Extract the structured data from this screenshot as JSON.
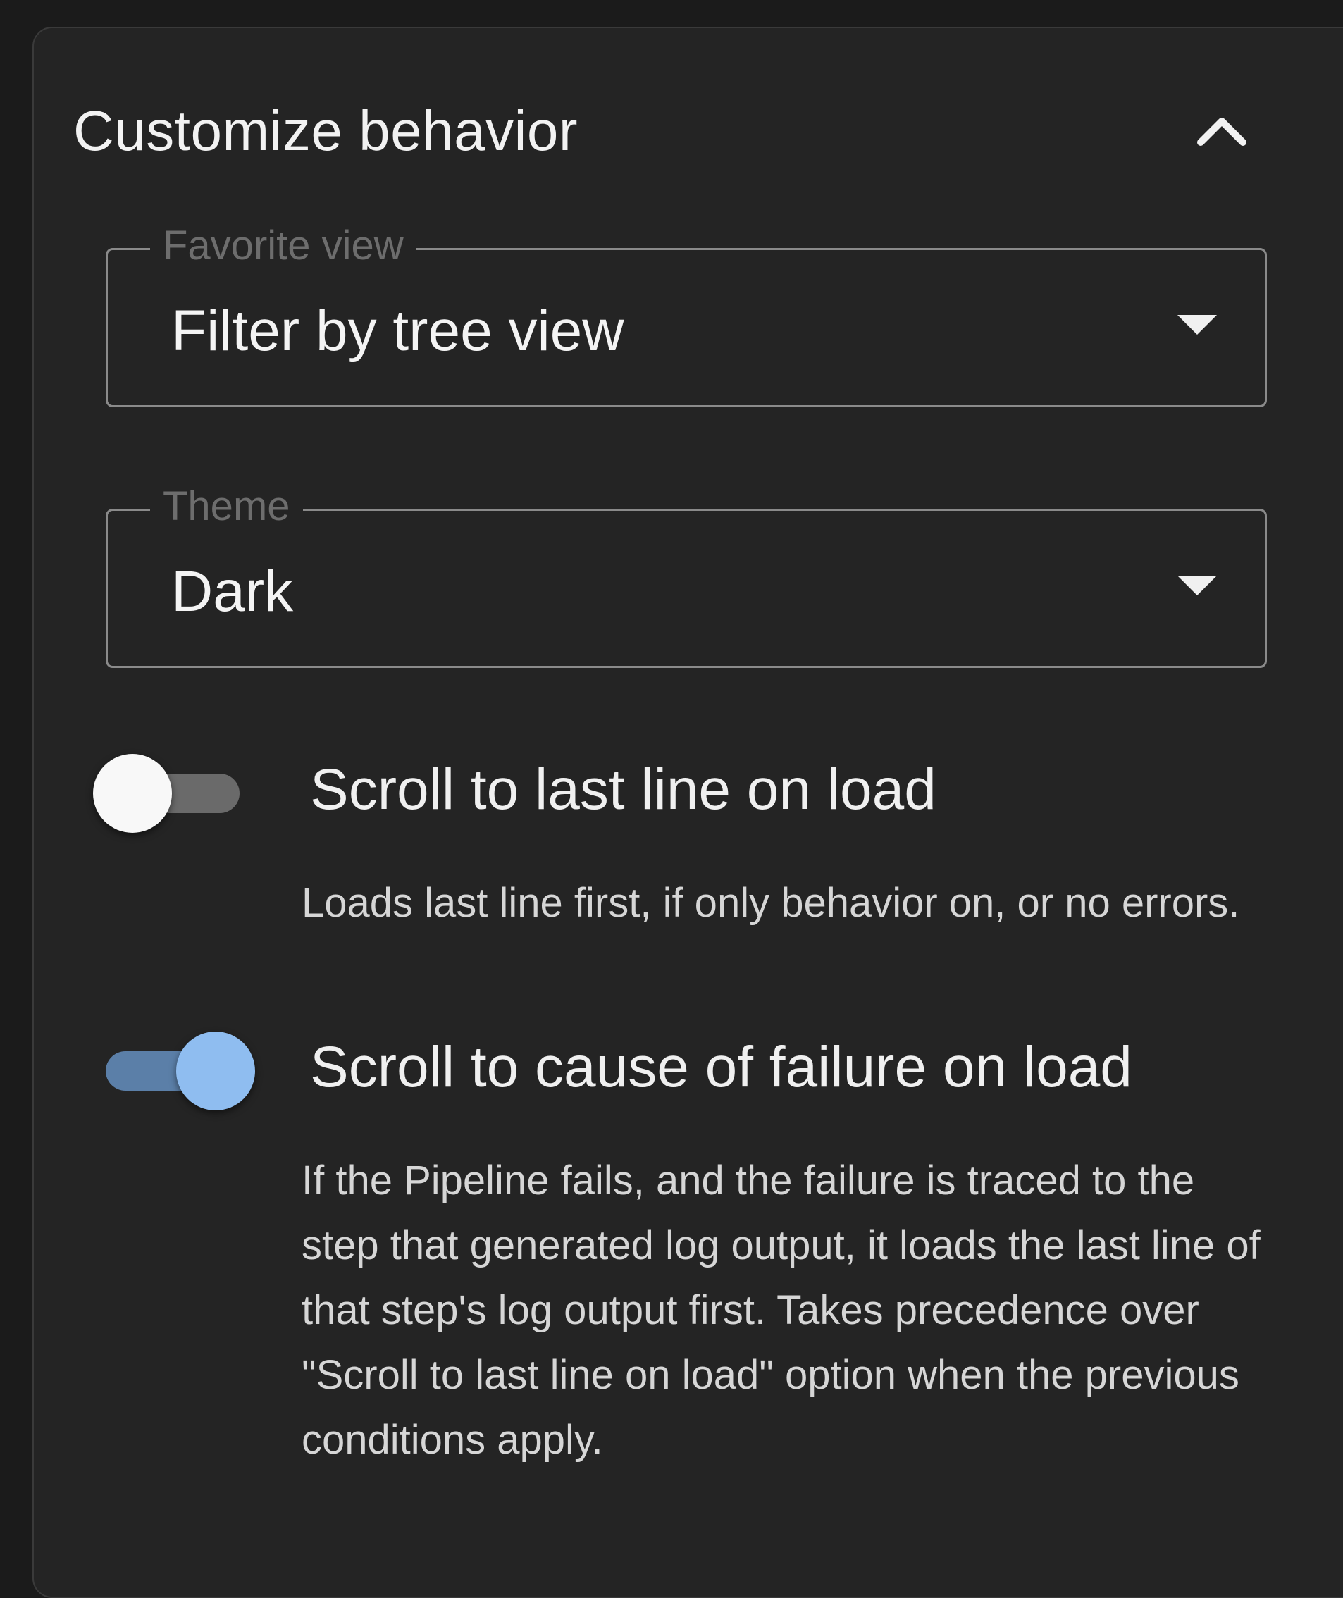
{
  "panel": {
    "title": "Customize behavior",
    "collapse_icon": "chevron-up-icon"
  },
  "favorite_view": {
    "label": "Favorite view",
    "value": "Filter by tree view"
  },
  "theme": {
    "label": "Theme",
    "value": "Dark"
  },
  "toggles": [
    {
      "label": "Scroll to last line on load",
      "description": "Loads last line first, if only behavior on, or no errors.",
      "enabled": false
    },
    {
      "label": "Scroll to cause of failure on load",
      "description": "If the Pipeline fails, and the failure is traced to the step that generated log output, it loads the last line of that step's log output first. Takes precedence over \"Scroll to last line on load\" option when the previous conditions apply.",
      "enabled": true
    }
  ],
  "colors": {
    "background": "#1b1b1b",
    "panel": "#242424",
    "switch_on_track": "#5b7fa8",
    "switch_on_thumb": "#8fbdf0",
    "switch_off_track": "#6a6a6a",
    "switch_off_thumb": "#f8f8f8"
  }
}
